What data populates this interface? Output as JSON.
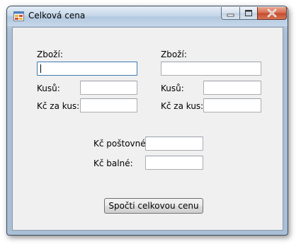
{
  "window": {
    "title": "Celková cena"
  },
  "left": {
    "item_label": "Zboží:",
    "item_value": "",
    "qty_label": "Kusů:",
    "qty_value": "",
    "price_label": "Kč za kus:",
    "price_value": ""
  },
  "right": {
    "item_label": "Zboží:",
    "item_value": "",
    "qty_label": "Kusů:",
    "qty_value": "",
    "price_label": "Kč za kus:",
    "price_value": ""
  },
  "fees": {
    "postage_label": "Kč poštovné:",
    "postage_value": "",
    "packing_label": "Kč balné:",
    "packing_value": ""
  },
  "actions": {
    "compute_label": "Spočti celkovou cenu"
  },
  "icons": {
    "app": "app-window-icon",
    "minimize": "minimize-icon",
    "maximize": "maximize-icon",
    "close": "close-icon"
  },
  "colors": {
    "client_bg": "#f0f0f0",
    "focus_border": "#3d7bad",
    "close_button": "#c44b2c"
  }
}
